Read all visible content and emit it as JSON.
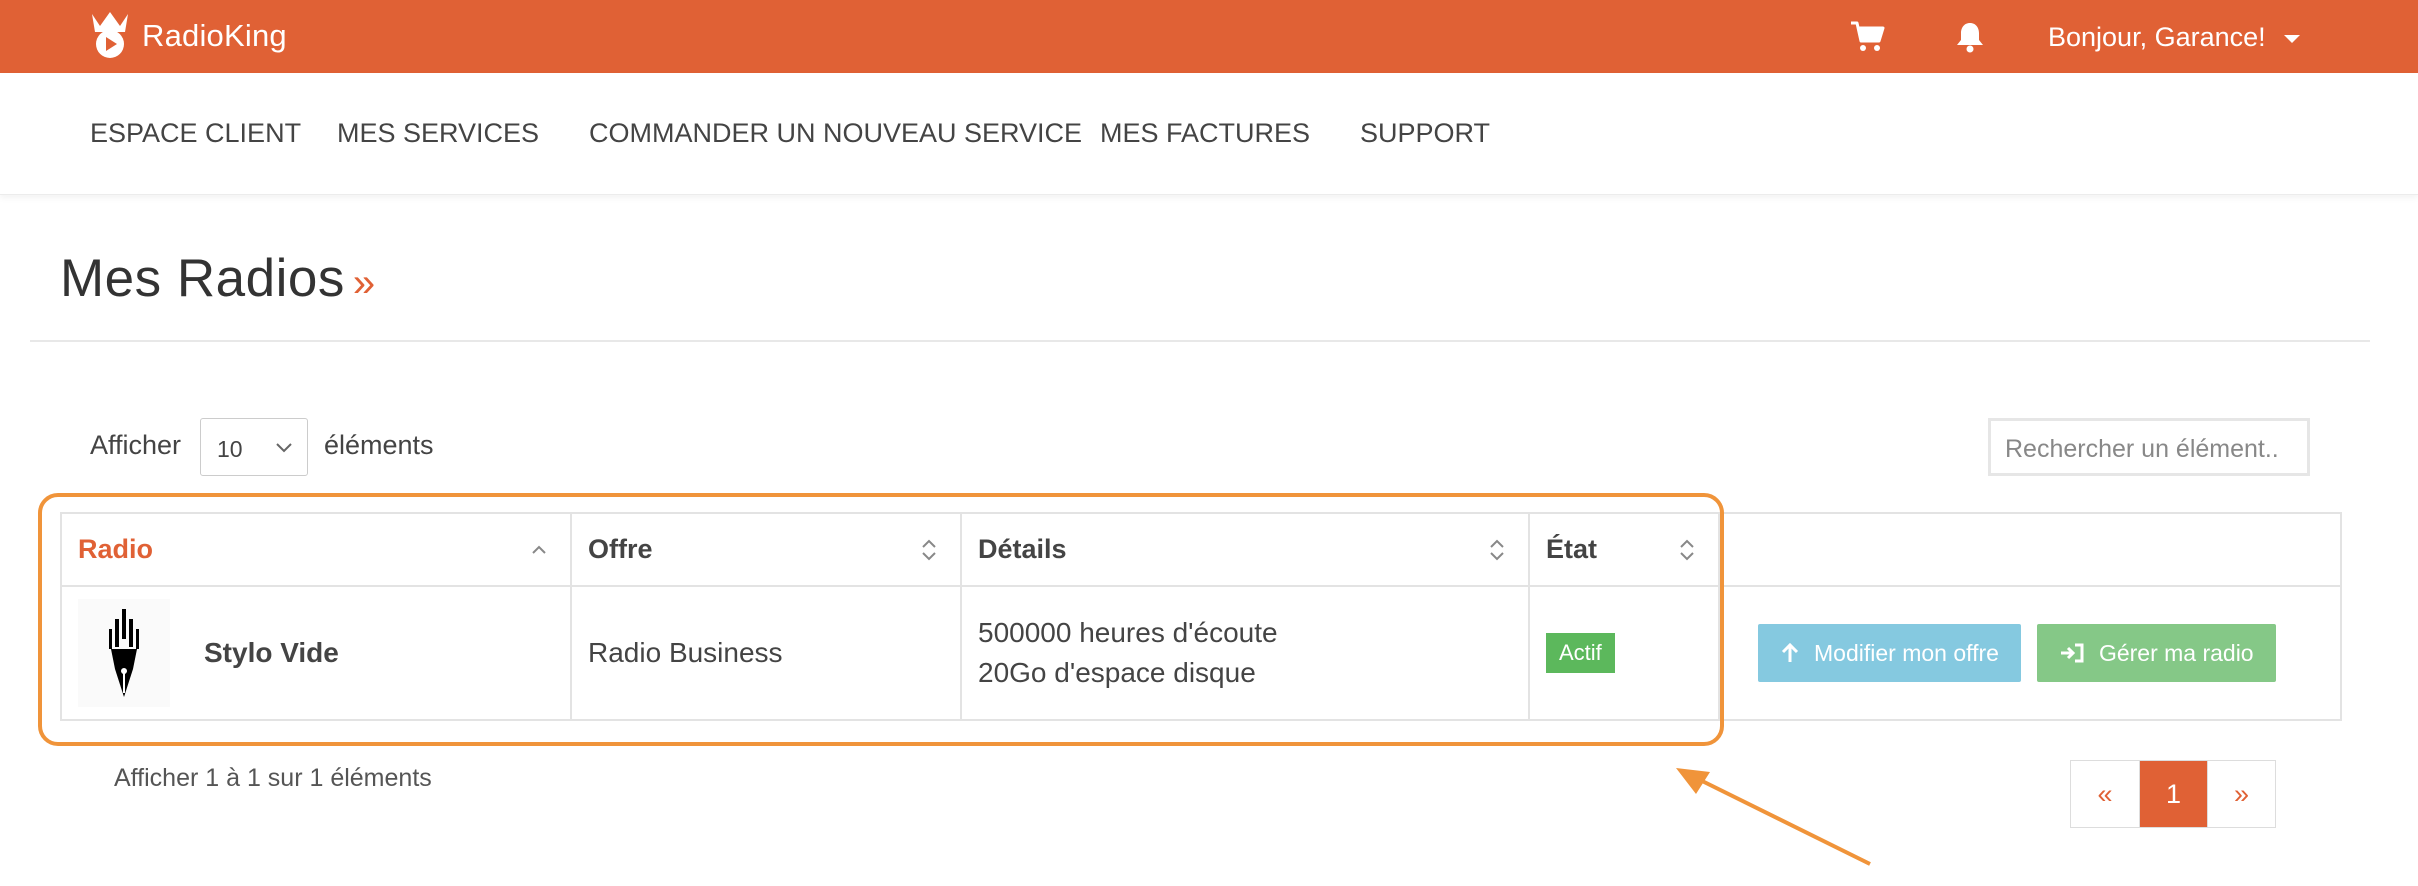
{
  "header": {
    "brand": "RadioKing",
    "greeting": "Bonjour, Garance!",
    "icons": {
      "logo": "crown-logo-icon",
      "cart": "cart-icon",
      "bell": "bell-icon",
      "caret": "caret-down-icon"
    },
    "accent_color": "#e06135"
  },
  "nav": {
    "items": [
      {
        "label": "ESPACE CLIENT"
      },
      {
        "label": "MES SERVICES"
      },
      {
        "label": "COMMANDER UN NOUVEAU SERVICE"
      },
      {
        "label": "MES FACTURES"
      },
      {
        "label": "SUPPORT"
      }
    ]
  },
  "page": {
    "title": "Mes Radios",
    "title_suffix": "»"
  },
  "controls": {
    "show_prefix": "Afficher",
    "page_length": "10",
    "show_suffix": "éléments",
    "search_placeholder": "Rechercher un élément.."
  },
  "table": {
    "columns": [
      {
        "label": "Radio",
        "sorted": "asc"
      },
      {
        "label": "Offre"
      },
      {
        "label": "Détails"
      },
      {
        "label": "État"
      },
      {
        "label": ""
      }
    ],
    "rows": [
      {
        "logo": "pen-nib-logo-icon",
        "radio": "Stylo Vide",
        "offre": "Radio Business",
        "details": [
          "500000 heures d'écoute",
          "20Go d'espace disque"
        ],
        "etat": "Actif",
        "actions": [
          {
            "label": "Modifier mon offre",
            "icon": "arrow-up-icon"
          },
          {
            "label": "Gérer ma radio",
            "icon": "sign-in-icon"
          }
        ]
      }
    ]
  },
  "footer": {
    "info": "Afficher 1 à 1 sur 1 éléments",
    "pagination": {
      "prev": "«",
      "current": "1",
      "next": "»"
    }
  },
  "annotation": {
    "highlight_color": "#f0943a"
  }
}
